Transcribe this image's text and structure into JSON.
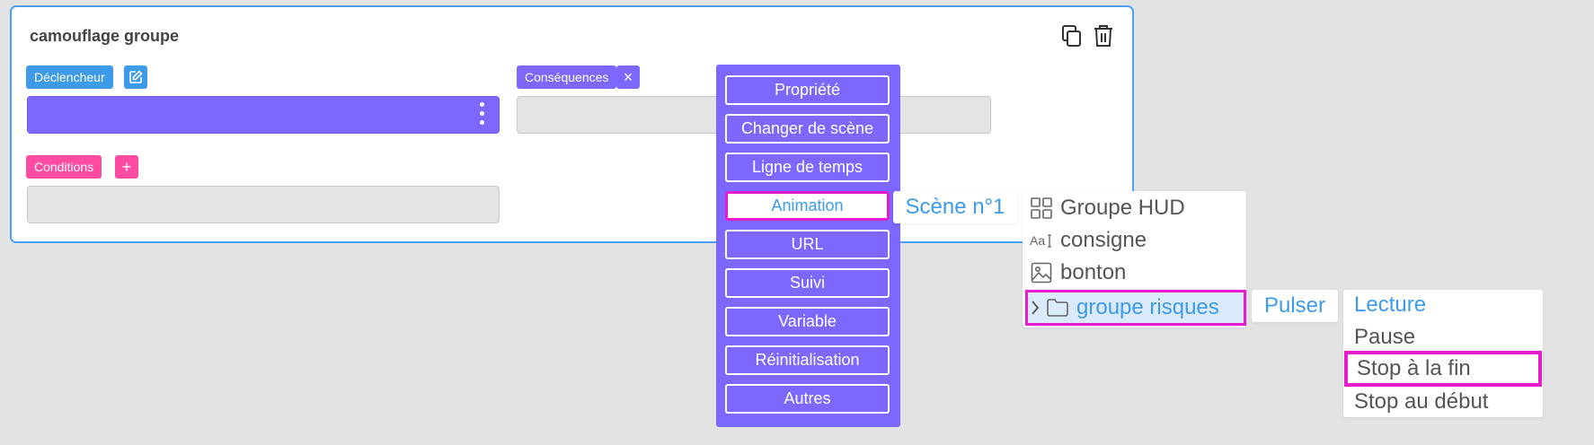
{
  "card": {
    "title": "camouflage groupe",
    "trigger_label": "Déclencheur",
    "consequences_label": "Conséquences",
    "conditions_label": "Conditions",
    "add_symbol": "+",
    "remove_symbol": "×"
  },
  "action_menu": {
    "items": [
      {
        "label": "Propriété"
      },
      {
        "label": "Changer de scène"
      },
      {
        "label": "Ligne de temps"
      },
      {
        "label": "Animation",
        "selected": true
      },
      {
        "label": "URL"
      },
      {
        "label": "Suivi"
      },
      {
        "label": "Variable"
      },
      {
        "label": "Réinitialisation"
      },
      {
        "label": "Autres"
      }
    ]
  },
  "scene_label": "Scène n°1",
  "tree": {
    "items": [
      {
        "label": "Groupe HUD",
        "icon": "grid-icon"
      },
      {
        "label": "consigne",
        "icon": "text-icon"
      },
      {
        "label": "bonton",
        "icon": "image-icon"
      },
      {
        "label": "groupe risques",
        "icon": "folder-icon",
        "selected": true
      }
    ]
  },
  "animation_label": "Pulser",
  "playback_options": [
    {
      "label": "Lecture",
      "active": true
    },
    {
      "label": "Pause"
    },
    {
      "label": "Stop à la fin",
      "selected": true
    },
    {
      "label": "Stop au début"
    }
  ],
  "colors": {
    "blue": "#3d9be9",
    "purple": "#7c67ff",
    "pink": "#ff4ba1",
    "highlight": "#e81ad0"
  }
}
